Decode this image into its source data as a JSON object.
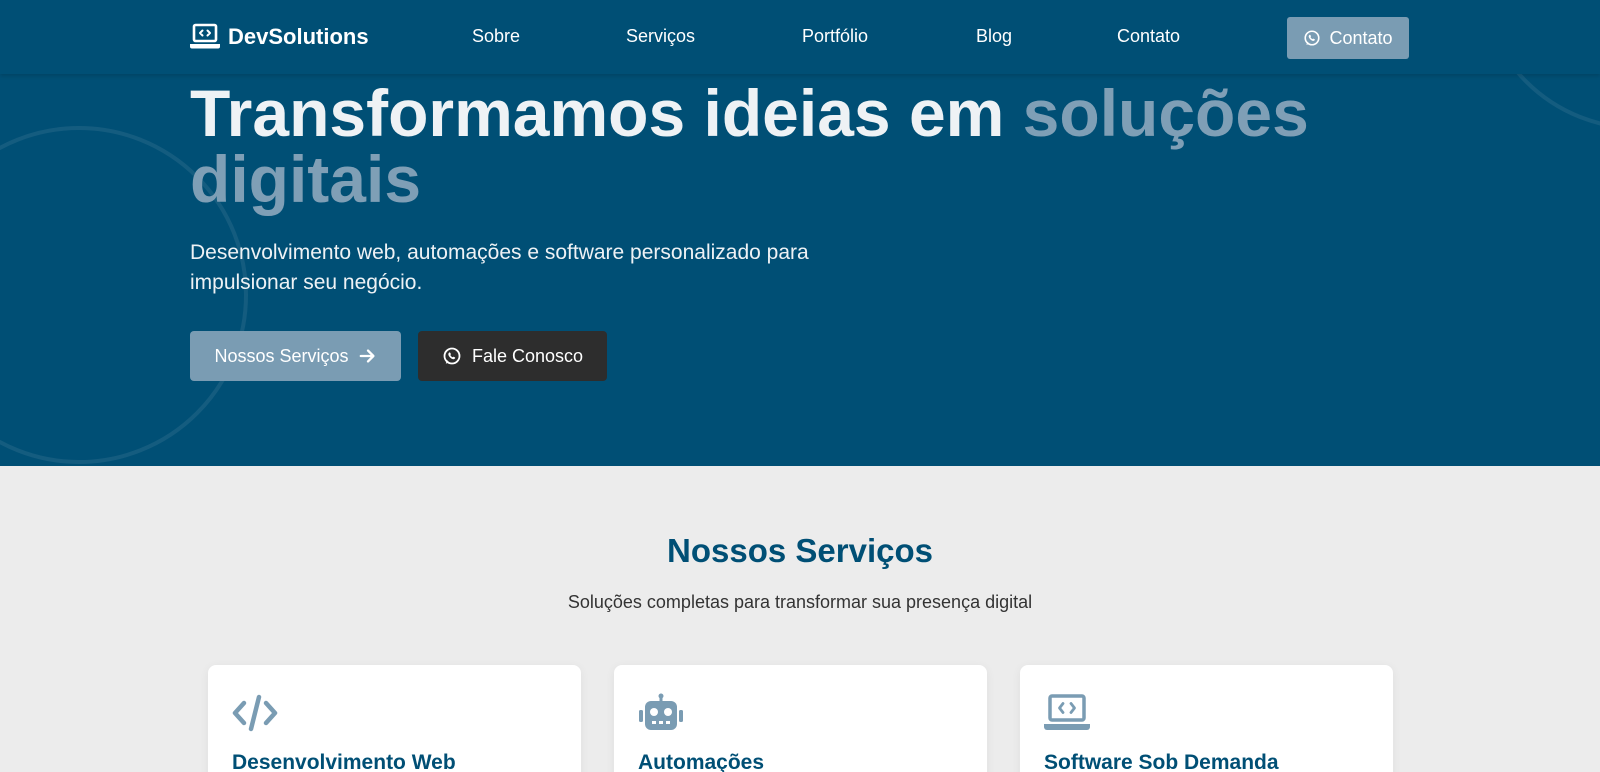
{
  "brand": {
    "name": "DevSolutions",
    "logo_icon": "laptop-code-icon"
  },
  "nav": {
    "links": [
      "Sobre",
      "Serviços",
      "Portfólio",
      "Blog",
      "Contato"
    ],
    "cta": {
      "label": "Contato",
      "icon": "whatsapp-icon"
    }
  },
  "hero": {
    "title_main": "Transformamos ideias em ",
    "title_accent": "soluções digitais",
    "subtitle": "Desenvolvimento web, automações e software personalizado para impulsionar seu negócio.",
    "primary_button": {
      "label": "Nossos Serviços",
      "icon": "arrow-right-icon"
    },
    "secondary_button": {
      "label": "Fale Conosco",
      "icon": "whatsapp-icon"
    }
  },
  "services": {
    "title": "Nossos Serviços",
    "subtitle": "Soluções completas para transformar sua presença digital",
    "cards": [
      {
        "icon": "code-icon",
        "title": "Desenvolvimento Web"
      },
      {
        "icon": "robot-icon",
        "title": "Automações"
      },
      {
        "icon": "laptop-code-icon",
        "title": "Software Sob Demanda"
      }
    ]
  },
  "colors": {
    "primary": "#004f75",
    "accent": "#7a9cb3",
    "dark_button": "#2d2d2d",
    "section_bg": "#ececec"
  }
}
